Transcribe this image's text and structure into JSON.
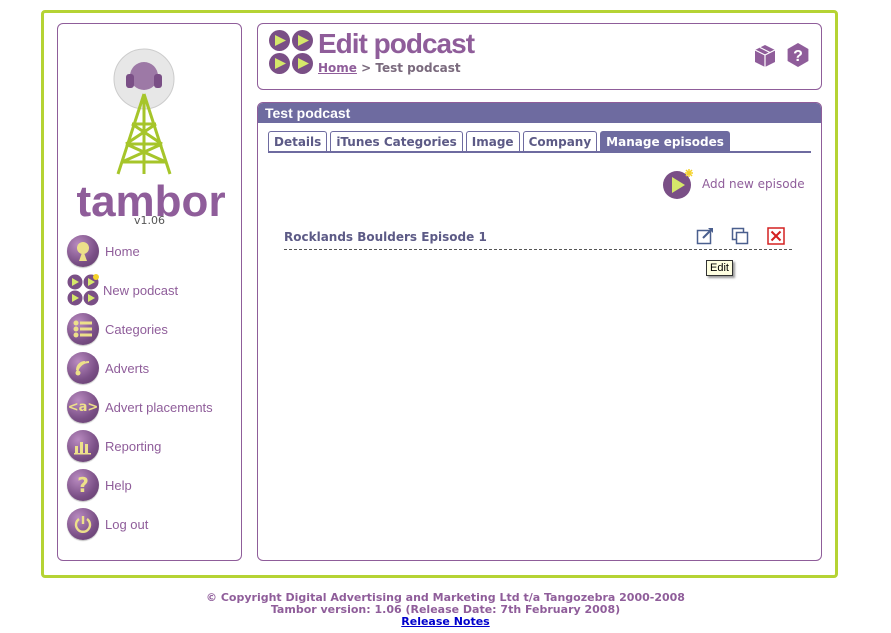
{
  "brand": {
    "name": "tambor",
    "version": "v1.06",
    "accent": "#8f5d9a",
    "border_green": "#b5d334"
  },
  "nav": [
    {
      "label": "Home",
      "icon": "home-icon"
    },
    {
      "label": "New podcast",
      "icon": "new-podcast-icon"
    },
    {
      "label": "Categories",
      "icon": "categories-icon"
    },
    {
      "label": "Adverts",
      "icon": "adverts-icon"
    },
    {
      "label": "Advert placements",
      "icon": "advert-placements-icon"
    },
    {
      "label": "Reporting",
      "icon": "reporting-icon"
    },
    {
      "label": "Help",
      "icon": "help-icon"
    },
    {
      "label": "Log out",
      "icon": "logout-icon"
    }
  ],
  "header": {
    "title": "Edit podcast",
    "breadcrumb_home": "Home",
    "breadcrumb_sep": " > ",
    "breadcrumb_current": "Test podcast"
  },
  "panel": {
    "title": "Test podcast",
    "tabs": [
      {
        "label": "Details"
      },
      {
        "label": "iTunes Categories"
      },
      {
        "label": "Image"
      },
      {
        "label": "Company"
      },
      {
        "label": "Manage episodes",
        "active": true
      }
    ],
    "add_episode_label": "Add new episode",
    "episodes": [
      {
        "title": "Rocklands Boulders Episode 1"
      }
    ],
    "tooltip": "Edit"
  },
  "footer": {
    "copyright": "© Copyright Digital Advertising and Marketing Ltd t/a Tangozebra 2000-2008",
    "version_line": "Tambor version: 1.06 (Release Date: 7th February 2008)",
    "release_notes": "Release Notes"
  }
}
